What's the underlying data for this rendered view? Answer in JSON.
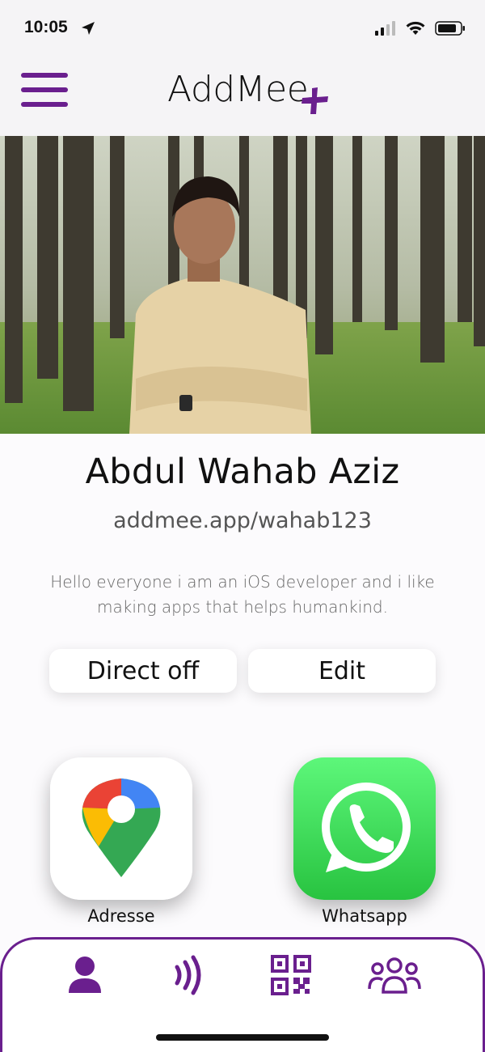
{
  "status_bar": {
    "time": "10:05"
  },
  "header": {
    "logo_text": "AddMee",
    "menu_icon": "hamburger-menu-icon",
    "brand_color": "#6a1f8e"
  },
  "profile": {
    "name": "Abdul Wahab Aziz",
    "link": "addmee.app/wahab123",
    "bio": "Hello everyone i am an iOS developer and i like making apps that helps humankind."
  },
  "actions": {
    "direct_label": "Direct off",
    "edit_label": "Edit"
  },
  "apps": [
    {
      "label": "Adresse",
      "icon": "google-maps-icon"
    },
    {
      "label": "Whatsapp",
      "icon": "whatsapp-icon"
    }
  ],
  "tabbar": {
    "items": [
      {
        "icon": "profile-icon"
      },
      {
        "icon": "nfc-icon"
      },
      {
        "icon": "qr-code-icon"
      },
      {
        "icon": "contacts-icon"
      }
    ]
  }
}
